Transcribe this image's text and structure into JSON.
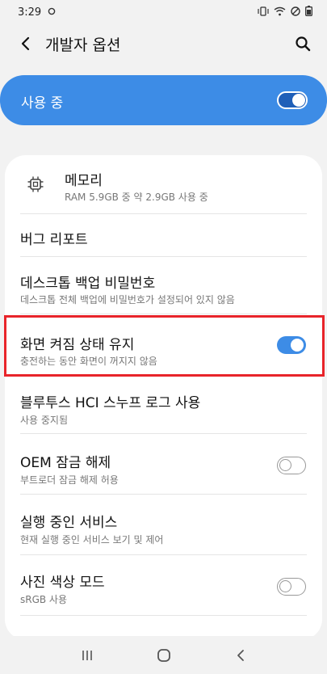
{
  "status_bar": {
    "time": "3:29",
    "notification_icon": "circle-icon",
    "right_icons": [
      "vibrate-icon",
      "wifi-icon",
      "dnd-icon",
      "battery-icon"
    ]
  },
  "app_bar": {
    "title": "개발자 옵션",
    "back_icon": "back-arrow-icon",
    "search_icon": "search-icon"
  },
  "master": {
    "label": "사용 중",
    "toggle_on": true
  },
  "items": [
    {
      "title": "메모리",
      "subtitle": "RAM 5.9GB 중 약 2.9GB 사용 중",
      "icon": "chip-icon",
      "toggle": null
    },
    {
      "title": "버그 리포트",
      "subtitle": "",
      "toggle": null
    },
    {
      "title": "데스크톱 백업 비밀번호",
      "subtitle": "데스크톱 전체 백업에 비밀번호가 설정되어 있지 않음",
      "toggle": null
    },
    {
      "title": "화면 켜짐 상태 유지",
      "subtitle": "충전하는 동안 화면이 꺼지지 않음",
      "toggle": true
    },
    {
      "title": "블루투스 HCI 스누프 로그 사용",
      "subtitle": "사용 중지됨",
      "toggle": null
    },
    {
      "title": "OEM 잠금 해제",
      "subtitle": "부트로더 잠금 해제 허용",
      "toggle": false
    },
    {
      "title": "실행 중인 서비스",
      "subtitle": "현재 실행 중인 서비스 보기 및 제어",
      "toggle": null
    },
    {
      "title": "사진 색상 모드",
      "subtitle": "sRGB 사용",
      "toggle": false
    }
  ],
  "nav_bar": {
    "recents_icon": "recents-icon",
    "home_icon": "home-icon",
    "back_icon": "nav-back-icon"
  },
  "colors": {
    "accent": "#3d8ce6",
    "highlight_border": "#e8242a"
  }
}
